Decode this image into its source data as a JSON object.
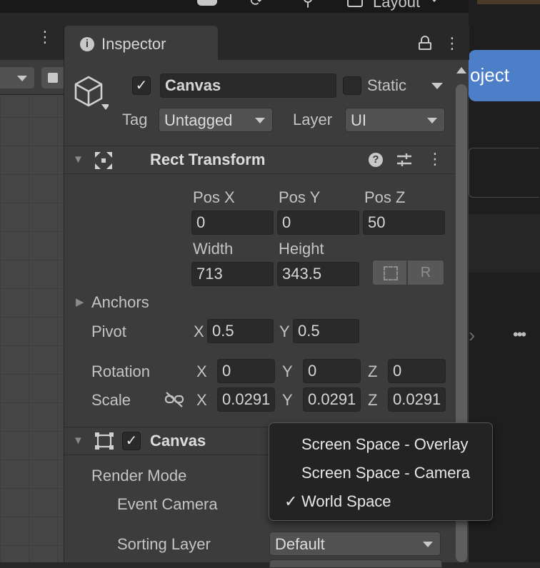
{
  "toolbar": {
    "layout_label": "Layout"
  },
  "right_panel": {
    "project_button": "oject",
    "more": "•••"
  },
  "inspector": {
    "tab_title": "Inspector",
    "object": {
      "active": "✓",
      "name": "Canvas",
      "static_label": "Static",
      "tag_label": "Tag",
      "tag_value": "Untagged",
      "layer_label": "Layer",
      "layer_value": "UI"
    },
    "rect_transform": {
      "title": "Rect Transform",
      "pos_x_label": "Pos X",
      "pos_x": "0",
      "pos_y_label": "Pos Y",
      "pos_y": "0",
      "pos_z_label": "Pos Z",
      "pos_z": "50",
      "width_label": "Width",
      "width": "713",
      "height_label": "Height",
      "height": "343.5",
      "r_button": "R",
      "anchors_label": "Anchors",
      "pivot_label": "Pivot",
      "pivot_x_label": "X",
      "pivot_x": "0.5",
      "pivot_y_label": "Y",
      "pivot_y": "0.5",
      "rotation_label": "Rotation",
      "rot_x_label": "X",
      "rot_x": "0",
      "rot_y_label": "Y",
      "rot_y": "0",
      "rot_z_label": "Z",
      "rot_z": "0",
      "scale_label": "Scale",
      "scale_x_label": "X",
      "scale_x": "0.0291",
      "scale_y_label": "Y",
      "scale_y": "0.0291",
      "scale_z_label": "Z",
      "scale_z": "0.0291"
    },
    "canvas": {
      "title": "Canvas",
      "enabled": "✓",
      "render_mode_label": "Render Mode",
      "event_camera_label": "Event Camera",
      "sorting_layer_label": "Sorting Layer",
      "sorting_layer_value": "Default"
    }
  },
  "render_mode_popup": {
    "items": [
      "Screen Space - Overlay",
      "Screen Space - Camera",
      "World Space"
    ],
    "selected_mark": "✓"
  }
}
